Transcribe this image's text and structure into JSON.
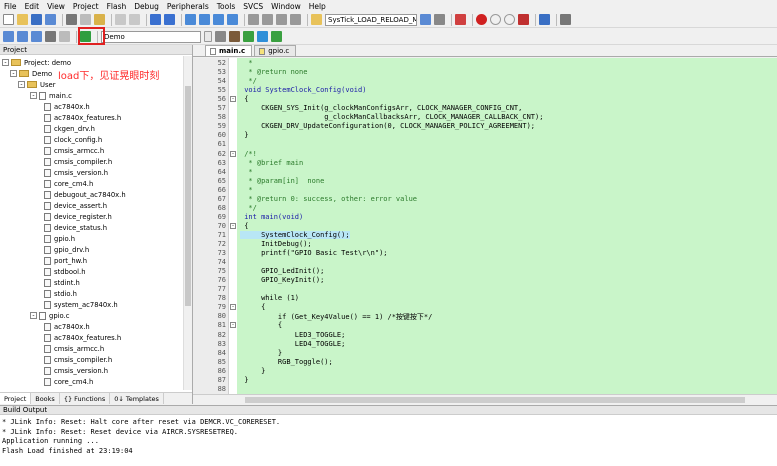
{
  "menu": [
    "File",
    "Edit",
    "View",
    "Project",
    "Flash",
    "Debug",
    "Peripherals",
    "Tools",
    "SVCS",
    "Window",
    "Help"
  ],
  "toolbar": {
    "function_combo": "SysTick_LOAD_RELOAD_M",
    "target_combo": "Demo"
  },
  "project_panel": {
    "title": "Project",
    "annotation": "load下，见证晃眼时刻",
    "tree": [
      {
        "label": "Project: demo",
        "level": 0,
        "kind": "root"
      },
      {
        "label": "Demo",
        "level": 1,
        "kind": "target"
      },
      {
        "label": "User",
        "level": 2,
        "kind": "folder"
      },
      {
        "label": "main.c",
        "level": 3,
        "kind": "cfile"
      },
      {
        "label": "ac7840x.h",
        "level": 4,
        "kind": "hfile"
      },
      {
        "label": "ac7840x_features.h",
        "level": 4,
        "kind": "hfile"
      },
      {
        "label": "ckgen_drv.h",
        "level": 4,
        "kind": "hfile"
      },
      {
        "label": "clock_config.h",
        "level": 4,
        "kind": "hfile"
      },
      {
        "label": "cmsis_armcc.h",
        "level": 4,
        "kind": "hfile"
      },
      {
        "label": "cmsis_compiler.h",
        "level": 4,
        "kind": "hfile"
      },
      {
        "label": "cmsis_version.h",
        "level": 4,
        "kind": "hfile"
      },
      {
        "label": "core_cm4.h",
        "level": 4,
        "kind": "hfile"
      },
      {
        "label": "debugout_ac7840x.h",
        "level": 4,
        "kind": "hfile"
      },
      {
        "label": "device_assert.h",
        "level": 4,
        "kind": "hfile"
      },
      {
        "label": "device_register.h",
        "level": 4,
        "kind": "hfile"
      },
      {
        "label": "device_status.h",
        "level": 4,
        "kind": "hfile"
      },
      {
        "label": "gpio.h",
        "level": 4,
        "kind": "hfile"
      },
      {
        "label": "gpio_drv.h",
        "level": 4,
        "kind": "hfile"
      },
      {
        "label": "port_hw.h",
        "level": 4,
        "kind": "hfile"
      },
      {
        "label": "stdbool.h",
        "level": 4,
        "kind": "hfile"
      },
      {
        "label": "stdint.h",
        "level": 4,
        "kind": "hfile"
      },
      {
        "label": "stdio.h",
        "level": 4,
        "kind": "hfile"
      },
      {
        "label": "system_ac7840x.h",
        "level": 4,
        "kind": "hfile"
      },
      {
        "label": "gpio.c",
        "level": 3,
        "kind": "cfile"
      },
      {
        "label": "ac7840x.h",
        "level": 4,
        "kind": "hfile"
      },
      {
        "label": "ac7840x_features.h",
        "level": 4,
        "kind": "hfile"
      },
      {
        "label": "cmsis_armcc.h",
        "level": 4,
        "kind": "hfile"
      },
      {
        "label": "cmsis_compiler.h",
        "level": 4,
        "kind": "hfile"
      },
      {
        "label": "cmsis_version.h",
        "level": 4,
        "kind": "hfile"
      },
      {
        "label": "core_cm4.h",
        "level": 4,
        "kind": "hfile"
      }
    ],
    "tabs": [
      "Project",
      "Books",
      "{} Functions",
      "0↓ Templates"
    ]
  },
  "editor": {
    "tabs": [
      {
        "label": "main.c",
        "active": true
      },
      {
        "label": "gpio.c",
        "active": false
      }
    ],
    "lines": [
      {
        "n": "52",
        "fold": "",
        "text": "  *",
        "cls": "cm"
      },
      {
        "n": "53",
        "fold": "",
        "text": "  * @return none",
        "cls": "cm"
      },
      {
        "n": "54",
        "fold": "",
        "text": "  */",
        "cls": "cm"
      },
      {
        "n": "55",
        "fold": "",
        "text": " void SystemClock_Config(void)",
        "cls": "kw"
      },
      {
        "n": "56",
        "fold": "-",
        "text": " {",
        "cls": ""
      },
      {
        "n": "57",
        "fold": "",
        "text": "     CKGEN_SYS_Init(g_clockManConfigsArr, CLOCK_MANAGER_CONFIG_CNT,",
        "cls": ""
      },
      {
        "n": "58",
        "fold": "",
        "text": "                    g_clockManCallbacksArr, CLOCK_MANAGER_CALLBACK_CNT);",
        "cls": ""
      },
      {
        "n": "59",
        "fold": "",
        "text": "     CKGEN_DRV_UpdateConfiguration(0, CLOCK_MANAGER_POLICY_AGREEMENT);",
        "cls": ""
      },
      {
        "n": "60",
        "fold": "",
        "text": " }",
        "cls": ""
      },
      {
        "n": "61",
        "fold": "",
        "text": "",
        "cls": ""
      },
      {
        "n": "62",
        "fold": "-",
        "text": " /*!",
        "cls": "cm"
      },
      {
        "n": "63",
        "fold": "",
        "text": "  * @brief main",
        "cls": "cm"
      },
      {
        "n": "64",
        "fold": "",
        "text": "  *",
        "cls": "cm"
      },
      {
        "n": "65",
        "fold": "",
        "text": "  * @param[in]  none",
        "cls": "cm"
      },
      {
        "n": "66",
        "fold": "",
        "text": "  *",
        "cls": "cm"
      },
      {
        "n": "67",
        "fold": "",
        "text": "  * @return 0: success, other: error value",
        "cls": "cm"
      },
      {
        "n": "68",
        "fold": "",
        "text": "  */",
        "cls": "cm"
      },
      {
        "n": "69",
        "fold": "",
        "text": " int main(void)",
        "cls": "kw"
      },
      {
        "n": "70",
        "fold": "-",
        "text": " {",
        "cls": ""
      },
      {
        "n": "71",
        "fold": "",
        "text": "     SystemClock_Config();",
        "cls": "hl"
      },
      {
        "n": "72",
        "fold": "",
        "text": "     InitDebug();",
        "cls": ""
      },
      {
        "n": "73",
        "fold": "",
        "text": "     printf(\"GPIO Basic Test\\r\\n\");",
        "cls": ""
      },
      {
        "n": "74",
        "fold": "",
        "text": "",
        "cls": ""
      },
      {
        "n": "75",
        "fold": "",
        "text": "     GPIO_LedInit();",
        "cls": ""
      },
      {
        "n": "76",
        "fold": "",
        "text": "     GPIO_KeyInit();",
        "cls": ""
      },
      {
        "n": "77",
        "fold": "",
        "text": "",
        "cls": ""
      },
      {
        "n": "78",
        "fold": "",
        "text": "     while (1)",
        "cls": ""
      },
      {
        "n": "79",
        "fold": "-",
        "text": "     {",
        "cls": ""
      },
      {
        "n": "80",
        "fold": "",
        "text": "         if (Get_Key4Value() == 1) /*按键按下*/",
        "cls": ""
      },
      {
        "n": "81",
        "fold": "-",
        "text": "         {",
        "cls": ""
      },
      {
        "n": "82",
        "fold": "",
        "text": "             LED3_TOGGLE;",
        "cls": ""
      },
      {
        "n": "83",
        "fold": "",
        "text": "             LED4_TOGGLE;",
        "cls": ""
      },
      {
        "n": "84",
        "fold": "",
        "text": "         }",
        "cls": ""
      },
      {
        "n": "85",
        "fold": "",
        "text": "         RGB_Toggle();",
        "cls": ""
      },
      {
        "n": "86",
        "fold": "",
        "text": "     }",
        "cls": ""
      },
      {
        "n": "87",
        "fold": "",
        "text": " }",
        "cls": ""
      },
      {
        "n": "88",
        "fold": "",
        "text": "",
        "cls": ""
      }
    ]
  },
  "build_output": {
    "title": "Build Output",
    "lines": [
      "* JLink Info: Reset: Halt core after reset via DEMCR.VC_CORERESET.",
      "* JLink Info: Reset: Reset device via AIRCR.SYSRESETREQ.",
      "Application running ...",
      "Flash Load finished at 23:19:04"
    ]
  }
}
